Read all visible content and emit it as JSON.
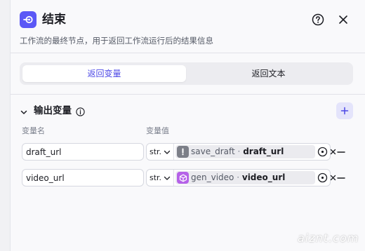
{
  "header": {
    "title": "结束",
    "description": "工作流的最终节点，用于返回工作流运行后的结果信息",
    "node_icon": "end-node-icon",
    "help_icon": "help-circle-icon",
    "close_icon": "close-icon"
  },
  "tabs": [
    {
      "label": "返回变量",
      "active": true
    },
    {
      "label": "返回文本",
      "active": false
    }
  ],
  "output_section": {
    "title": "输出变量",
    "columns": {
      "name": "变量名",
      "value": "变量值"
    },
    "rows": [
      {
        "name": "draft_url",
        "type": "str.",
        "ref_node": "save_draft",
        "ref_sep": "·",
        "ref_field": "draft_url",
        "ref_icon": "exclamation-icon",
        "ref_icon_color": "#7c7f88"
      },
      {
        "name": "video_url",
        "type": "str.",
        "ref_node": "gen_video",
        "ref_sep": "·",
        "ref_field": "video_url",
        "ref_icon": "cube-icon",
        "ref_icon_color": "#b561e8"
      }
    ]
  },
  "colors": {
    "accent": "#5b58f6",
    "tab_active_text": "#4c48e6",
    "panel_bg": "#f9f9fb"
  },
  "watermark": "aiznt.com"
}
